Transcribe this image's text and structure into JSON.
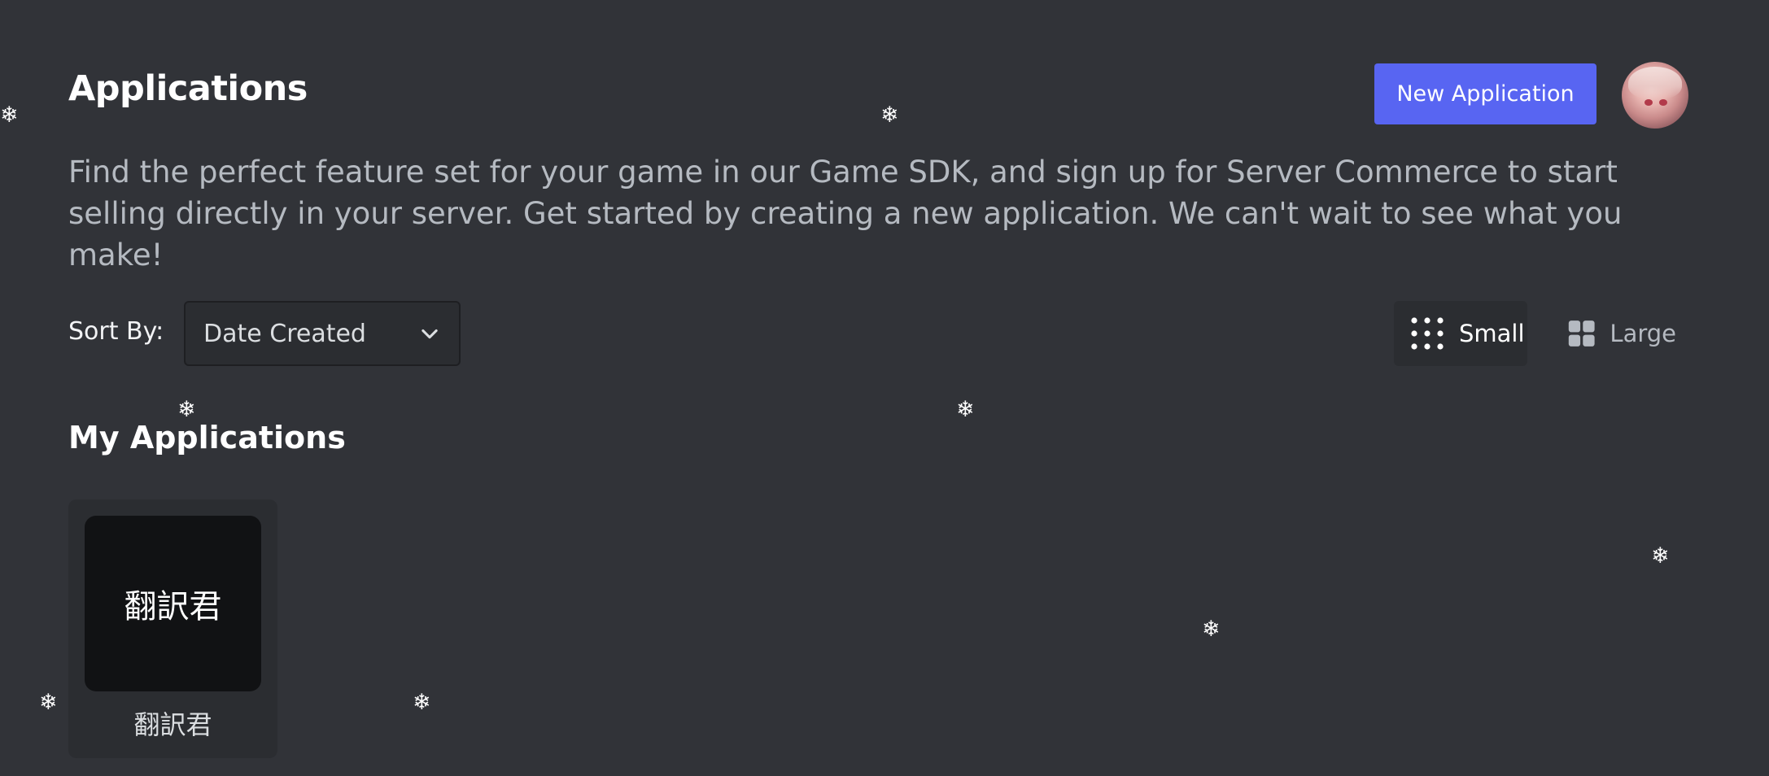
{
  "header": {
    "title": "Applications",
    "new_app_label": "New Application",
    "description": "Find the perfect feature set for your game in our Game SDK, and sign up for Server Commerce to start selling directly in your server. Get started by creating a new application. We can't wait to see what you make!"
  },
  "sort": {
    "label": "Sort By:",
    "selected": "Date Created"
  },
  "view_toggle": {
    "small_label": "Small",
    "large_label": "Large",
    "selected": "Small"
  },
  "my_apps": {
    "title": "My Applications",
    "items": [
      {
        "icon_text": "翻訳君",
        "name": "翻訳君"
      }
    ]
  },
  "decorations": {
    "snowflake_glyph": "❄"
  },
  "colors": {
    "background": "#313338",
    "accent": "#5865f2",
    "card": "#2b2d31",
    "app_icon_bg": "#111214"
  }
}
